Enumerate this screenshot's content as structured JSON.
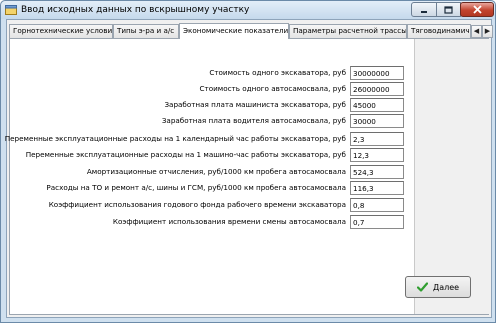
{
  "window": {
    "title": "Ввод исходных данных по вскрышному участку"
  },
  "tabs": [
    {
      "label": "Горнотехнические условия"
    },
    {
      "label": "Типы э-ра и а/с"
    },
    {
      "label": "Экономические показатели"
    },
    {
      "label": "Параметры расчетной трассы"
    },
    {
      "label": "Тяговодинамиче"
    }
  ],
  "active_tab": "Экономические показатели",
  "fields": [
    {
      "label": "Стоимость одного экскаватора, руб",
      "value": "30000000"
    },
    {
      "label": "Стоимость одного автосамосвала, руб",
      "value": "26000000"
    },
    {
      "label": "Заработная плата машиниста экскаватора, руб",
      "value": "45000"
    },
    {
      "label": "Заработная плата водителя автосамосвала, руб",
      "value": "30000"
    },
    {
      "label": "Переменные эксплуатационные расходы на 1 календарный час работы экскаватора, руб",
      "value": "2,3"
    },
    {
      "label": "Переменные эксплуатационные расходы на 1 машино-час работы экскаватора, руб",
      "value": "12,3"
    },
    {
      "label": "Амортизационные отчисления, руб/1000 км пробега автосамосвала",
      "value": "524,3"
    },
    {
      "label": "Расходы на ТО и ремонт а/с, шины и ГСМ, руб/1000 км пробега автосамосвала",
      "value": "116,3"
    },
    {
      "label": "Коэффициент использования годового фонда рабочего времени экскаватора",
      "value": "0,8"
    },
    {
      "label": "Коэффициент использования времени смены автосамосвала",
      "value": "0,7"
    }
  ],
  "buttons": {
    "next_label": "Далее"
  },
  "colors": {
    "accent_check": "#2f9e2f",
    "close_button": "#c2442f"
  }
}
